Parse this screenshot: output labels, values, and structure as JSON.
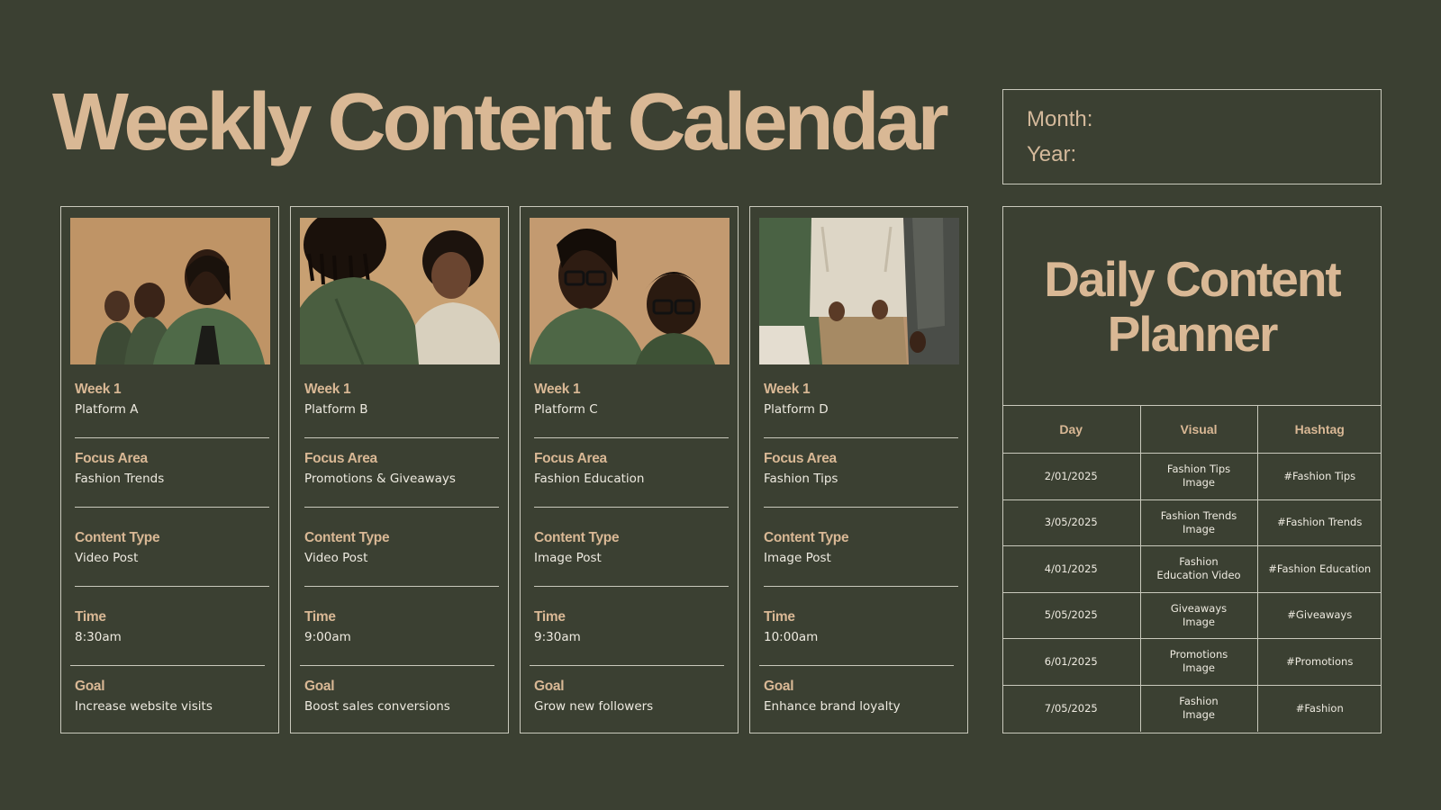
{
  "title": "Weekly Content Calendar",
  "month_year": {
    "month_label": "Month:",
    "year_label": "Year:"
  },
  "field_labels": {
    "focus": "Focus Area",
    "content_type": "Content Type",
    "time": "Time",
    "goal": "Goal"
  },
  "cards": [
    {
      "week": "Week 1",
      "platform": "Platform A",
      "focus": "Fashion Trends",
      "content_type": "Video Post",
      "time": "8:30am",
      "goal": "Increase website visits"
    },
    {
      "week": "Week 1",
      "platform": "Platform B",
      "focus": "Promotions & Giveaways",
      "content_type": "Video Post",
      "time": "9:00am",
      "goal": "Boost sales conversions"
    },
    {
      "week": "Week 1",
      "platform": "Platform C",
      "focus": "Fashion Education",
      "content_type": "Image Post",
      "time": "9:30am",
      "goal": "Grow new followers"
    },
    {
      "week": "Week 1",
      "platform": "Platform D",
      "focus": "Fashion Tips",
      "content_type": "Image Post",
      "time": "10:00am",
      "goal": "Enhance brand loyalty"
    }
  ],
  "planner": {
    "title_line1": "Daily Content",
    "title_line2": "Planner",
    "headers": {
      "day": "Day",
      "visual": "Visual",
      "hashtag": "Hashtag"
    },
    "rows": [
      {
        "day": "2/01/2025",
        "visual_1": "Fashion Tips",
        "visual_2": "Image",
        "hashtag": "#Fashion Tips"
      },
      {
        "day": "3/05/2025",
        "visual_1": "Fashion Trends",
        "visual_2": "Image",
        "hashtag": "#Fashion Trends"
      },
      {
        "day": "4/01/2025",
        "visual_1": "Fashion",
        "visual_2": "Education Video",
        "hashtag": "#Fashion Education"
      },
      {
        "day": "5/05/2025",
        "visual_1": "Giveaways",
        "visual_2": "Image",
        "hashtag": "#Giveaways"
      },
      {
        "day": "6/01/2025",
        "visual_1": "Promotions",
        "visual_2": "Image",
        "hashtag": "#Promotions"
      },
      {
        "day": "7/05/2025",
        "visual_1": "Fashion",
        "visual_2": "Image",
        "hashtag": "#Fashion"
      }
    ]
  },
  "colors": {
    "background": "#3b4032",
    "accent": "#d9b895",
    "text": "#eeeae0",
    "border": "#c9c9bc"
  },
  "icons": [
    "photo-models-1",
    "photo-models-2",
    "photo-models-3",
    "photo-models-4"
  ]
}
